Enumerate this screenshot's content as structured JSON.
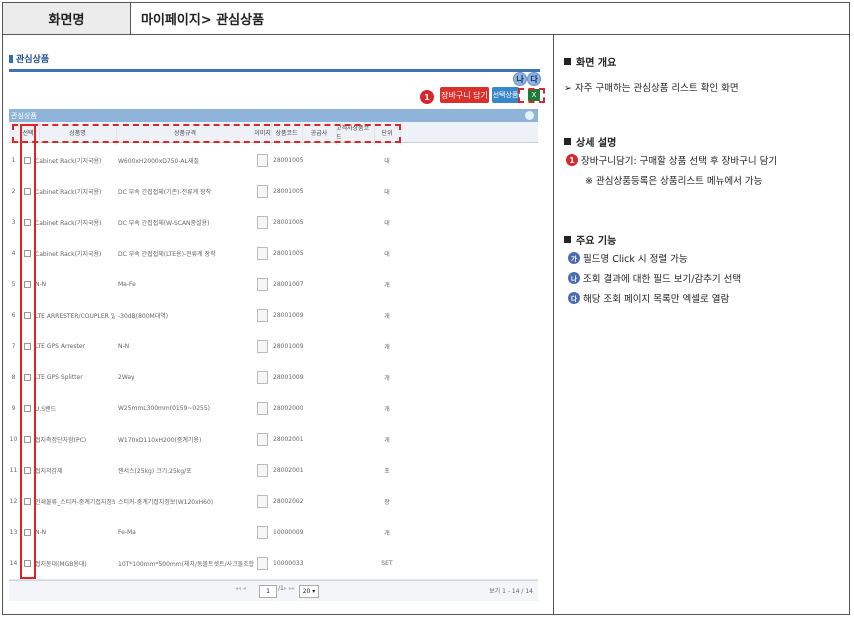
{
  "header": {
    "label": "화면명",
    "value": "마이페이지> 관심상품"
  },
  "panel": {
    "title": "관심상품",
    "grid_title": "관심상품",
    "buttons": {
      "cart": "장바구니 담기",
      "select": "선택상품"
    },
    "markers": {
      "one": "1",
      "ga": "가",
      "na": "나",
      "da": "다"
    },
    "columns": [
      "선택",
      "상품명",
      "상품규격",
      "이미지",
      "상품코드",
      "공급사",
      "고객사상품코드",
      "단위"
    ],
    "rows": [
      {
        "no": "1",
        "name": "Cabinet Rack(기지국용)",
        "spec": "W600xH2000xD750-AL재질",
        "code": "2800100582",
        "unit": "대"
      },
      {
        "no": "2",
        "name": "Cabinet Rack(기지국용)",
        "spec": "DC 부속 간접접체(기존)-전류계 장착",
        "code": "2800100583",
        "unit": "대"
      },
      {
        "no": "3",
        "name": "Cabinet Rack(기지국용)",
        "spec": "DC 부속 간접접체(W-SCAN중설용)",
        "code": "2800100584",
        "unit": "대"
      },
      {
        "no": "4",
        "name": "Cabinet Rack(기지국용)",
        "spec": "DC 부속 간접접체(LTE용)-전류계 장착",
        "code": "2800100585",
        "unit": "대"
      },
      {
        "no": "5",
        "name": "N-N",
        "spec": "Ma-Fe",
        "code": "2800100762",
        "unit": "개"
      },
      {
        "no": "6",
        "name": "LTE ARRESTER/COUPLER 일체형(0M)",
        "spec": "-30dB(800M대역)",
        "code": "2800100970",
        "unit": "개"
      },
      {
        "no": "7",
        "name": "LTE GPS Arrester",
        "spec": "N-N",
        "code": "2800100971",
        "unit": "개"
      },
      {
        "no": "8",
        "name": "LTE GPS Splitter",
        "spec": "2Way",
        "code": "2800100972",
        "unit": "개"
      },
      {
        "no": "9",
        "name": "U.S밴드",
        "spec": "W25mmL300mm(0159~0255)",
        "code": "2800200051",
        "unit": "개"
      },
      {
        "no": "10",
        "name": "접지측정단자함(PC)",
        "spec": "W170xD110xH200(중계기용)",
        "code": "2800200127",
        "unit": "개"
      },
      {
        "no": "11",
        "name": "접지저감제",
        "spec": "젠서스(25kg) 크기:25kg/포",
        "code": "2800200193",
        "unit": "포"
      },
      {
        "no": "12",
        "name": "인쇄물류_스티커-중계기접지정보(W)",
        "spec": "스티커-중계기접지정보(W120xH60)",
        "code": "2800200232",
        "unit": "장"
      },
      {
        "no": "13",
        "name": "N-N",
        "spec": "Fe-Ma",
        "code": "1000000925",
        "unit": "개"
      },
      {
        "no": "14",
        "name": "접지동대(MGB용대)",
        "spec": "10T*100mm*500mm(체자/동볼트셋트/사크돌조합)",
        "code": "1000003384",
        "unit": "SET"
      }
    ],
    "pager": {
      "page": "1",
      "total": "/1",
      "size": "20",
      "prev": "◂◂ ◂",
      "next": "▸ ▸▸",
      "count": "보기 1 - 14 / 14"
    }
  },
  "right": {
    "overview_title": "화면 개요",
    "overview_text": "➢ 자주 구매하는 관심상품 리스트 확인 화면",
    "detail_title": "상세 설명",
    "detail_item": "장바구니담기: 구매할 상품 선택 후 장바구니 담기",
    "detail_note": "※ 관심상품등록은 상품리스트 메뉴에서 가능",
    "func_title": "주요 기능",
    "func_items": [
      {
        "mark": "가",
        "text": "필드명 Click 시 정렬 가능"
      },
      {
        "mark": "나",
        "text": "조회 결과에 대한 필드 보기/감추기 선택"
      },
      {
        "mark": "다",
        "text": "해당 조회 페이지 목록만 엑셀로 열람"
      }
    ]
  },
  "colors": {
    "accent_red": "#d8262b",
    "grid_blue": "#8fb4d9",
    "title_blue": "#1f4e8c"
  }
}
